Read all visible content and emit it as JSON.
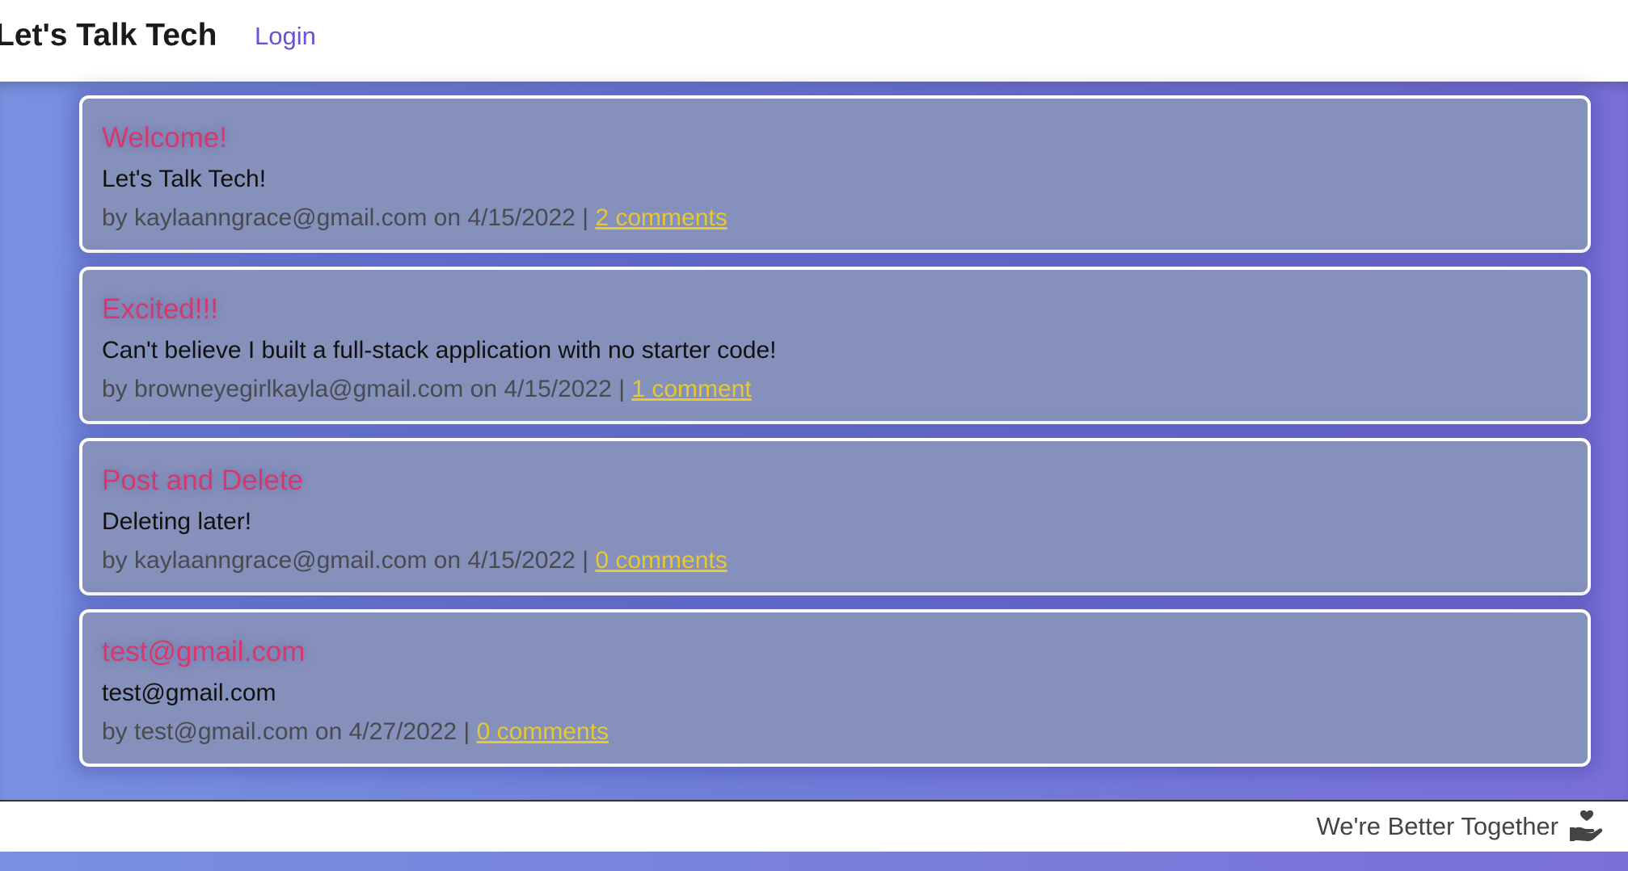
{
  "header": {
    "brand": "Let's Talk Tech",
    "login_label": "Login"
  },
  "posts": [
    {
      "title": "Welcome!",
      "body": "Let's Talk Tech!",
      "author": "kaylaanngrace@gmail.com",
      "date": "4/15/2022",
      "comments": "2 comments"
    },
    {
      "title": "Excited!!!",
      "body": "Can't believe I built a full-stack application with no starter code!",
      "author": "browneyegirlkayla@gmail.com",
      "date": "4/15/2022",
      "comments": "1 comment"
    },
    {
      "title": "Post and Delete",
      "body": "Deleting later!",
      "author": "kaylaanngrace@gmail.com",
      "date": "4/15/2022",
      "comments": "0 comments"
    },
    {
      "title": "test@gmail.com",
      "body": "test@gmail.com",
      "author": "test@gmail.com",
      "date": "4/27/2022",
      "comments": "0 comments"
    }
  ],
  "meta": {
    "by": "by",
    "on": "on",
    "separator": "|"
  },
  "footer": {
    "text": "We're Better Together",
    "icon": "hand-heart-icon"
  },
  "colors": {
    "title": "#d7386b",
    "link": "#6a4fd8",
    "comments_link": "#e5c832",
    "card_background": "#8590bb"
  }
}
